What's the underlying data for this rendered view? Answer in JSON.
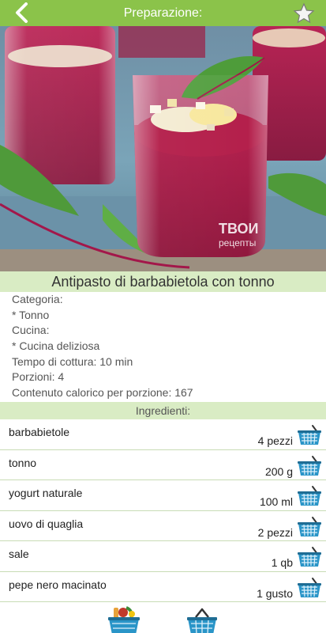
{
  "header": {
    "title": "Preparazione:",
    "back_icon": "back-chevron-icon",
    "favorite_icon": "star-icon"
  },
  "photo": {
    "watermark_line1": "ТВОИ",
    "watermark_line2": "рецепты"
  },
  "recipe": {
    "title": "Antipasto di barbabietola con tonno",
    "category_label": "Categoria:",
    "category_value": "* Tonno",
    "cuisine_label": "Cucina:",
    "cuisine_value": "* Cucina deliziosa",
    "cooking_time": "Tempo di cottura: 10 min",
    "servings": "Porzioni: 4",
    "calories": "Contenuto calorico per porzione: 167"
  },
  "ingredients": {
    "header": "Ingredienti:",
    "items": [
      {
        "name": "barbabietole",
        "qty": "4 pezzi"
      },
      {
        "name": "tonno",
        "qty": "200 g"
      },
      {
        "name": "yogurt naturale",
        "qty": "100 ml"
      },
      {
        "name": "uovo di quaglia",
        "qty": "2 pezzi"
      },
      {
        "name": "sale",
        "qty": "1 qb"
      },
      {
        "name": "pepe nero macinato",
        "qty": "1 gusto"
      }
    ]
  },
  "colors": {
    "accent": "#8bc34a",
    "section_bg": "#d9ecc4",
    "cart": "#2a95c8"
  }
}
